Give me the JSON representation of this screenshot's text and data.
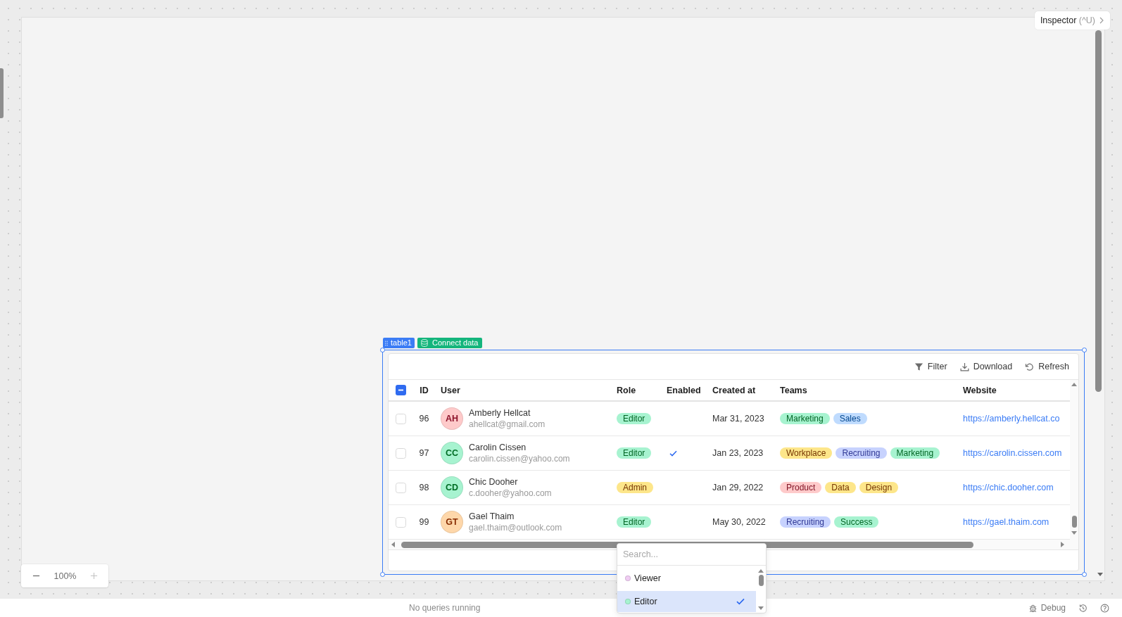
{
  "workspace": {
    "inspector": {
      "label": "Inspector",
      "shortcut": "(^U)"
    },
    "zoom_control": {
      "value": "100%",
      "zoom_out_disabled": false,
      "zoom_in_disabled": true
    }
  },
  "component": {
    "name": "table1",
    "connect_label": "Connect data"
  },
  "table": {
    "toolbar": [
      {
        "kind": "filter",
        "label": "Filter"
      },
      {
        "kind": "download",
        "label": "Download"
      },
      {
        "kind": "refresh",
        "label": "Refresh"
      }
    ],
    "header_checkbox": {
      "indeterminate": true
    },
    "columns": [
      "ID",
      "User",
      "Role",
      "Enabled",
      "Created at",
      "Teams",
      "Website"
    ],
    "rows": [
      {
        "selected": false,
        "id": "96",
        "avatar": {
          "initials": "AH",
          "color": "#fecaca"
        },
        "name": "Amberly Hellcat",
        "email": "ahellcat@gmail.com",
        "role": {
          "label": "Editor",
          "color": "#a7f3d0"
        },
        "enabled": false,
        "created": "Mar 31, 2023",
        "teams": [
          {
            "label": "Marketing",
            "color": "#a7f3d0"
          },
          {
            "label": "Sales",
            "color": "#bfdbfe"
          }
        ],
        "website": "https://amberly.hellcat.co"
      },
      {
        "selected": false,
        "id": "97",
        "avatar": {
          "initials": "CC",
          "color": "#a7f3d0"
        },
        "name": "Carolin Cissen",
        "email": "carolin.cissen@yahoo.com",
        "role": {
          "label": "Editor",
          "color": "#a7f3d0"
        },
        "enabled": true,
        "created": "Jan 23, 2023",
        "teams": [
          {
            "label": "Workplace",
            "color": "#fde68a"
          },
          {
            "label": "Recruiting",
            "color": "#c7d2fe"
          },
          {
            "label": "Marketing",
            "color": "#a7f3d0"
          }
        ],
        "website": "https://carolin.cissen.com"
      },
      {
        "selected": false,
        "id": "98",
        "avatar": {
          "initials": "CD",
          "color": "#a7f3d0"
        },
        "name": "Chic Dooher",
        "email": "c.dooher@yahoo.com",
        "role": {
          "label": "Admin",
          "color": "#fde68a"
        },
        "enabled": false,
        "created": "Jan 29, 2022",
        "teams": [
          {
            "label": "Product",
            "color": "#fecaca"
          },
          {
            "label": "Data",
            "color": "#fde68a"
          },
          {
            "label": "Design",
            "color": "#fde68a"
          }
        ],
        "website": "https://chic.dooher.com"
      },
      {
        "selected": false,
        "id": "99",
        "avatar": {
          "initials": "GT",
          "color": "#fed7aa"
        },
        "name": "Gael Thaim",
        "email": "gael.thaim@outlook.com",
        "role": {
          "label": "Editor",
          "color": "#a7f3d0"
        },
        "enabled": false,
        "created": "May 30, 2022",
        "teams": [
          {
            "label": "Recruiting",
            "color": "#c7d2fe"
          },
          {
            "label": "Success",
            "color": "#a7f3d0"
          }
        ],
        "website": "https://gael.thaim.com"
      }
    ]
  },
  "role_dropdown": {
    "placeholder": "Search...",
    "options": [
      {
        "label": "Viewer",
        "color": "#f0cdf3",
        "selected": false
      },
      {
        "label": "Editor",
        "color": "#a7f3d0",
        "selected": true
      }
    ]
  },
  "status_bar": {
    "message": "No queries running",
    "debug_label": "Debug"
  }
}
